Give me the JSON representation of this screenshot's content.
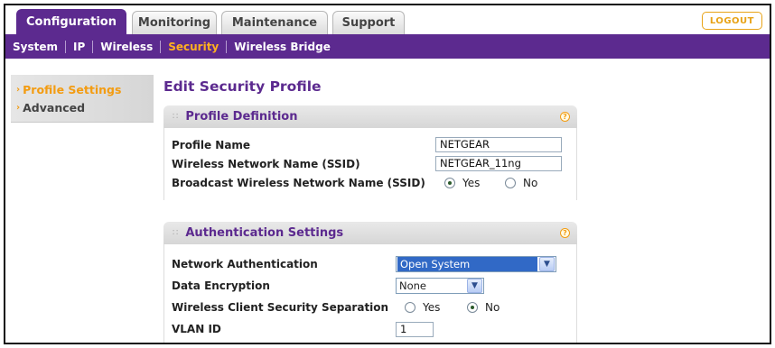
{
  "tabs": [
    {
      "label": "Configuration",
      "active": true
    },
    {
      "label": "Monitoring",
      "active": false
    },
    {
      "label": "Maintenance",
      "active": false
    },
    {
      "label": "Support",
      "active": false
    }
  ],
  "logout_label": "LOGOUT",
  "subnav": [
    {
      "label": "System",
      "active": false
    },
    {
      "label": "IP",
      "active": false
    },
    {
      "label": "Wireless",
      "active": false
    },
    {
      "label": "Security",
      "active": true
    },
    {
      "label": "Wireless Bridge",
      "active": false
    }
  ],
  "sidenav": [
    {
      "label": "Profile Settings",
      "active": true
    },
    {
      "label": "Advanced",
      "active": false
    }
  ],
  "page_title": "Edit Security Profile",
  "profile_definition": {
    "title": "Profile Definition",
    "profile_name_label": "Profile Name",
    "profile_name_value": "NETGEAR",
    "ssid_label": "Wireless Network Name (SSID)",
    "ssid_value": "NETGEAR_11ng",
    "broadcast_label": "Broadcast Wireless Network Name (SSID)",
    "broadcast_yes": "Yes",
    "broadcast_no": "No",
    "broadcast_selected": "Yes"
  },
  "authentication": {
    "title": "Authentication Settings",
    "network_auth_label": "Network Authentication",
    "network_auth_value": "Open System",
    "data_encryption_label": "Data Encryption",
    "data_encryption_value": "None",
    "separation_label": "Wireless Client Security Separation",
    "separation_yes": "Yes",
    "separation_no": "No",
    "separation_selected": "No",
    "vlan_label": "VLAN ID",
    "vlan_value": "1"
  },
  "help_glyph": "?",
  "colors": {
    "brand_purple": "#5c2a8f",
    "accent_orange": "#f39c12"
  }
}
